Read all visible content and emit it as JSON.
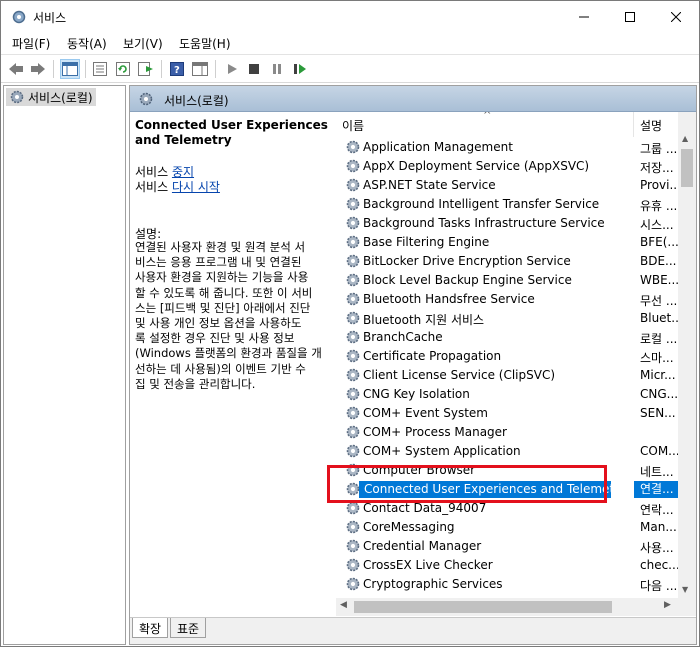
{
  "window": {
    "title": "서비스"
  },
  "menu": [
    "파일(F)",
    "동작(A)",
    "보기(V)",
    "도움말(H)"
  ],
  "tree": {
    "root_label": "서비스(로컬)"
  },
  "right_header": {
    "title": "서비스(로컬)"
  },
  "description_panel": {
    "service_title": "Connected User Experiences and Telemetry",
    "action_stop_prefix": "서비스 ",
    "action_stop_link": "중지",
    "action_restart_prefix": "서비스 ",
    "action_restart_link": "다시 시작",
    "desc_label": "설명:",
    "desc_text": "연결된 사용자 환경 및 원격 분석 서\n비스는 응용 프로그램 내 및 연결된\n사용자 환경을 지원하는 기능을 사용\n할 수 있도록 해 줍니다. 또한 이 서비\n스는 [피드백 및 진단] 아래에서 진단\n및 사용 개인 정보 옵션을 사용하도\n록 설정한 경우 진단 및 사용 정보\n(Windows 플랫폼의 환경과 품질을 개\n선하는 데 사용됨)의 이벤트 기반 수\n집 및 전송을 관리합니다."
  },
  "list": {
    "columns": {
      "name": "이름",
      "description": "설명"
    },
    "rows": [
      {
        "name": "Application Management",
        "desc": "그룹 ..."
      },
      {
        "name": "AppX Deployment Service (AppXSVC)",
        "desc": "저장..."
      },
      {
        "name": "ASP.NET State Service",
        "desc": "Provi..."
      },
      {
        "name": "Background Intelligent Transfer Service",
        "desc": "유휴 ..."
      },
      {
        "name": "Background Tasks Infrastructure Service",
        "desc": "시스..."
      },
      {
        "name": "Base Filtering Engine",
        "desc": "BFE(..."
      },
      {
        "name": "BitLocker Drive Encryption Service",
        "desc": "BDE..."
      },
      {
        "name": "Block Level Backup Engine Service",
        "desc": "WBE..."
      },
      {
        "name": "Bluetooth Handsfree Service",
        "desc": "무선 ..."
      },
      {
        "name": "Bluetooth 지원 서비스",
        "desc": "Bluet..."
      },
      {
        "name": "BranchCache",
        "desc": "로컬 ..."
      },
      {
        "name": "Certificate Propagation",
        "desc": "스마..."
      },
      {
        "name": "Client License Service (ClipSVC)",
        "desc": "Micr..."
      },
      {
        "name": "CNG Key Isolation",
        "desc": "CNG..."
      },
      {
        "name": "COM+ Event System",
        "desc": "SEN..."
      },
      {
        "name": "COM+ Process Manager",
        "desc": ""
      },
      {
        "name": "COM+ System Application",
        "desc": "COM..."
      },
      {
        "name": "Computer Browser",
        "desc": "네트..."
      },
      {
        "name": "Connected User Experiences and Telemetry",
        "desc": "연결..."
      },
      {
        "name": "Contact Data_94007",
        "desc": "연락..."
      },
      {
        "name": "CoreMessaging",
        "desc": "Man..."
      },
      {
        "name": "Credential Manager",
        "desc": "사용..."
      },
      {
        "name": "CrossEX Live Checker",
        "desc": "chec..."
      },
      {
        "name": "Cryptographic Services",
        "desc": "다음 ..."
      }
    ],
    "selected_index": 18
  },
  "tabs": [
    "확장",
    "표준"
  ],
  "colors": {
    "selection": "#0078d7",
    "highlight_box": "#e3101c",
    "link": "#0645ad"
  }
}
